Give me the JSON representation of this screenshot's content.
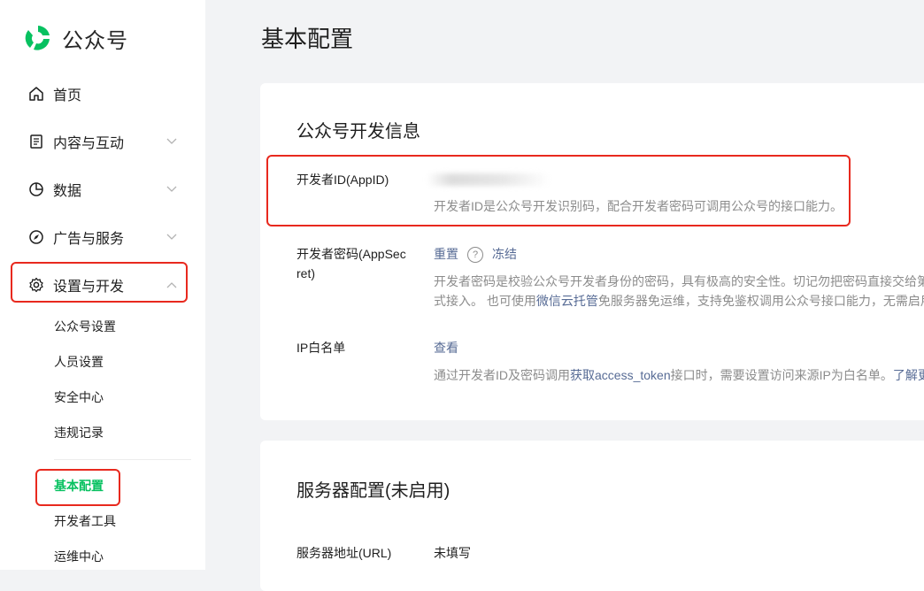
{
  "logo": {
    "text": "公众号"
  },
  "sidebar": {
    "items": [
      {
        "label": "首页",
        "icon": "home-icon"
      },
      {
        "label": "内容与互动",
        "icon": "document-icon"
      },
      {
        "label": "数据",
        "icon": "pie-chart-icon"
      },
      {
        "label": "广告与服务",
        "icon": "compass-icon"
      },
      {
        "label": "设置与开发",
        "icon": "gear-icon"
      }
    ],
    "sub_items": [
      "公众号设置",
      "人员设置",
      "安全中心",
      "违规记录",
      "基本配置",
      "开发者工具",
      "运维中心"
    ]
  },
  "page": {
    "title": "基本配置"
  },
  "dev_info": {
    "title": "公众号开发信息",
    "appid_label": "开发者ID(AppID)",
    "appid_desc": "开发者ID是公众号开发识别码，配合开发者密码可调用公众号的接口能力。",
    "secret_label_line1": "开发者密码(AppSec",
    "secret_label_line2": "ret)",
    "secret_reset": "重置",
    "secret_help": "?",
    "secret_freeze": "冻结",
    "secret_desc_line1": "开发者密码是校验公众号开发者身份的密码，具有极高的安全性。切记勿把密码直接交给第",
    "secret_desc_line2_a": "式接入。 也可使用",
    "secret_desc_line2_link": "微信云托管",
    "secret_desc_line2_b": "免服务器免运维，支持免鉴权调用公众号接口能力，无需启用",
    "ip_label": "IP白名单",
    "ip_view": "查看",
    "ip_desc_a": "通过开发者ID及密码调用",
    "ip_desc_link": "获取access_token",
    "ip_desc_b": "接口时，需要设置访问来源IP为白名单。",
    "ip_desc_more": "了解更"
  },
  "server_config": {
    "title": "服务器配置(未启用)",
    "url_label": "服务器地址(URL)",
    "url_value": "未填写"
  },
  "colors": {
    "accent": "#07c160",
    "link": "#576b95",
    "highlight": "#e8291e"
  }
}
